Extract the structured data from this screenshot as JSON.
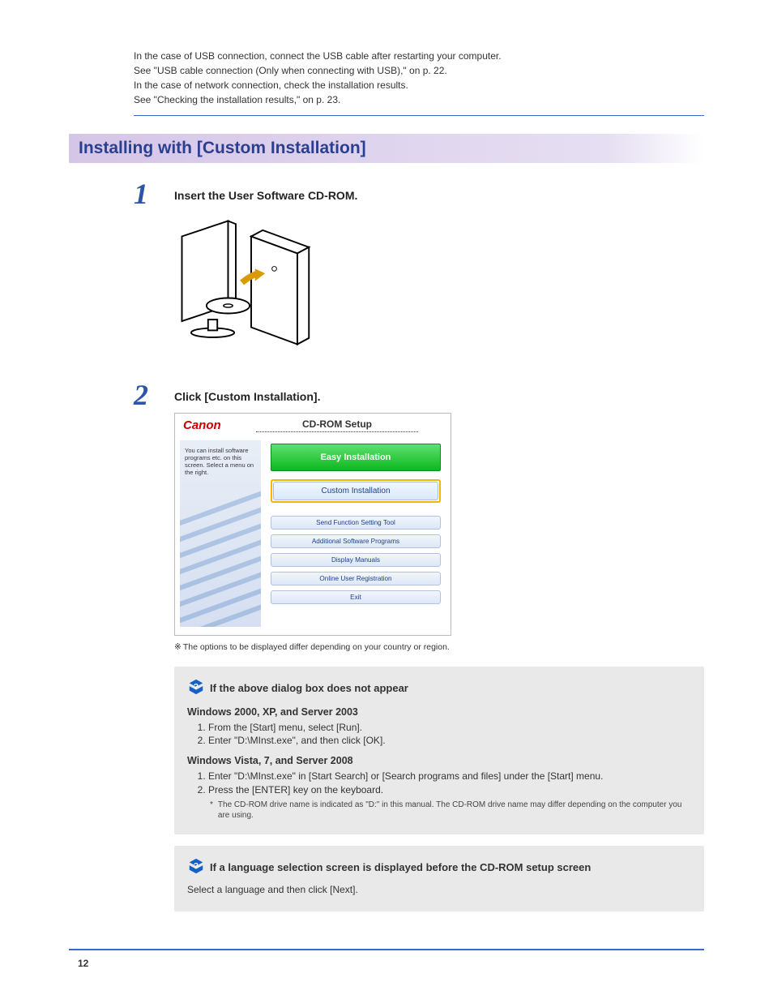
{
  "intro": {
    "line1": "In the case of USB connection, connect the USB cable after restarting your computer.",
    "line2": "See \"USB cable connection (Only when connecting with USB),\" on p. 22.",
    "line3": "In the case of network connection, check the installation results.",
    "line4": "See \"Checking the installation results,\" on p. 23."
  },
  "section_heading": "Installing with [Custom Installation]",
  "steps": {
    "s1": {
      "num": "1",
      "title": "Insert the User Software CD-ROM."
    },
    "s2": {
      "num": "2",
      "title": "Click [Custom Installation]."
    }
  },
  "screenshot": {
    "brand": "Canon",
    "title": "CD-ROM Setup",
    "sidebar_text": "You can install software programs etc. on this screen. Select a menu on the right.",
    "buttons": {
      "easy": "Easy Installation",
      "custom": "Custom Installation",
      "send_tool": "Send Function Setting Tool",
      "additional": "Additional Software Programs",
      "manuals": "Display Manuals",
      "registration": "Online User Registration",
      "exit": "Exit"
    }
  },
  "options_note": "The options to be displayed differ depending on your country or region.",
  "callout1": {
    "heading": "If the above dialog box does not appear",
    "win_xp_head": "Windows 2000, XP, and Server 2003",
    "xp1": "From the [Start] menu, select [Run].",
    "xp2": "Enter \"D:\\MInst.exe\", and then click [OK].",
    "win_vista_head": "Windows Vista, 7, and Server 2008",
    "v1": "Enter \"D:\\MInst.exe\" in [Start Search] or [Search programs and files] under the [Start] menu.",
    "v2": "Press the [ENTER] key on the keyboard.",
    "footnote": "The CD-ROM drive name is indicated as \"D:\" in this manual. The CD-ROM drive name may differ depending on the computer you are using."
  },
  "callout2": {
    "heading": "If a language selection screen is displayed before the CD-ROM setup screen",
    "body": "Select a language and then click [Next]."
  },
  "page_number": "12"
}
